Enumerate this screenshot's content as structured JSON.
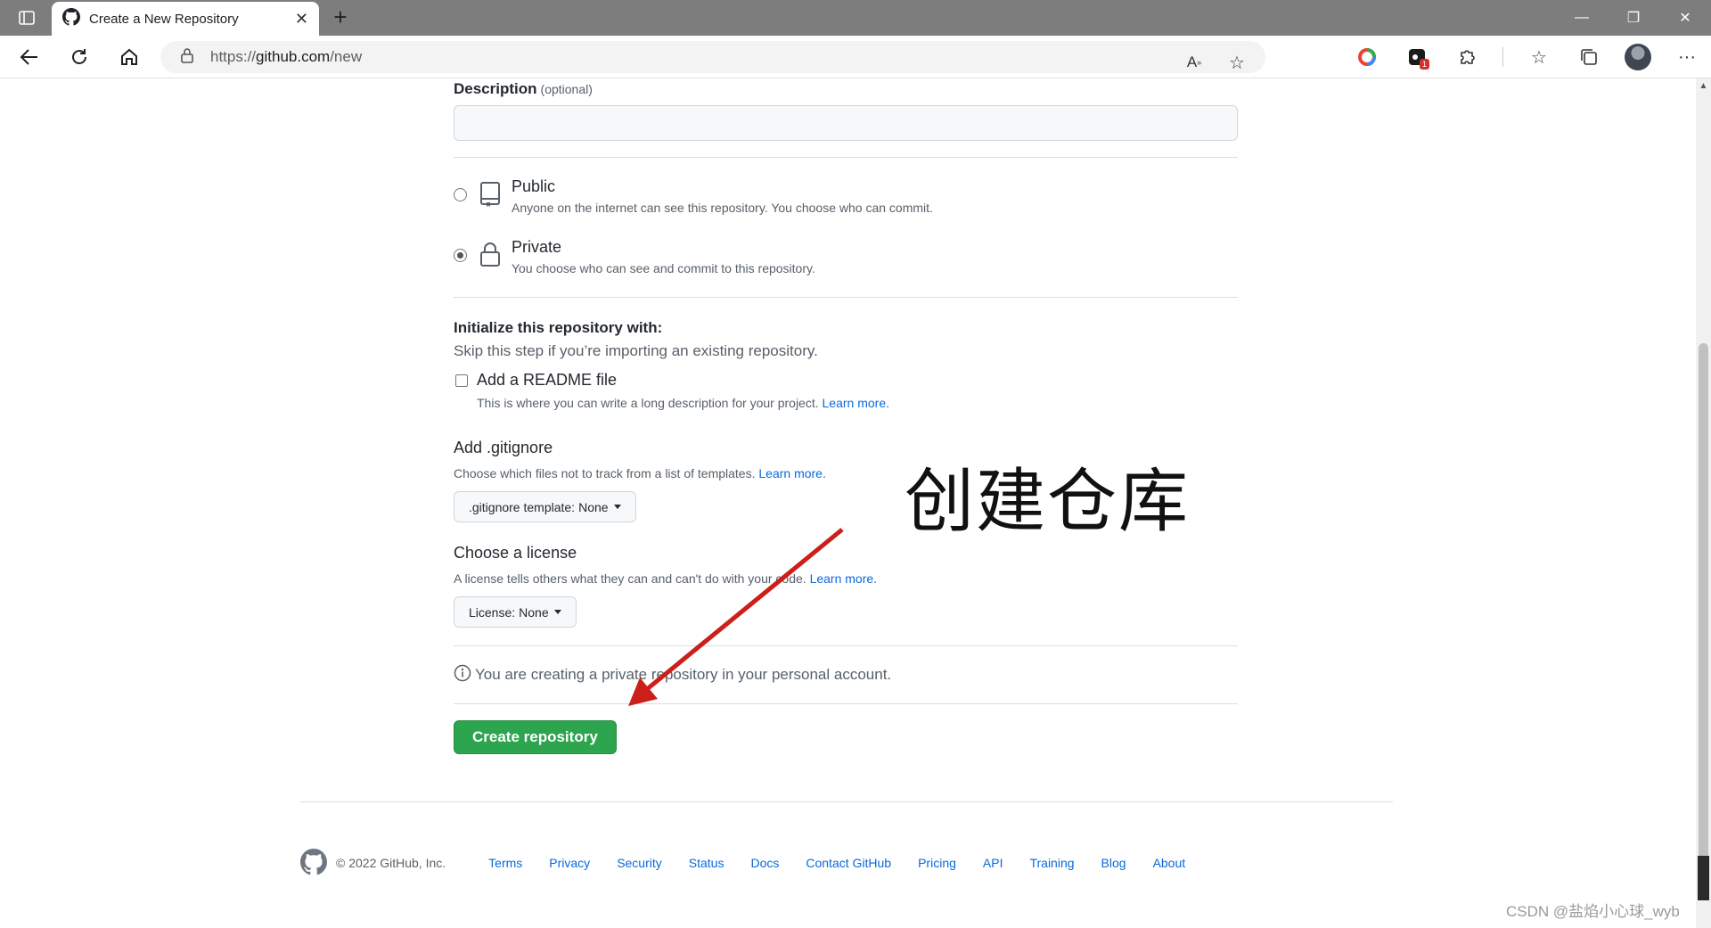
{
  "browser": {
    "tab_title": "Create a New Repository",
    "url_prefix": "https://",
    "url_host": "github.com",
    "url_path": "/new",
    "extension_badge": "1"
  },
  "form": {
    "description_label": "Description",
    "description_optional": "(optional)",
    "visibility": [
      {
        "title": "Public",
        "desc": "Anyone on the internet can see this repository. You choose who can commit.",
        "checked": false
      },
      {
        "title": "Private",
        "desc": "You choose who can see and commit to this repository.",
        "checked": true
      }
    ],
    "init_title": "Initialize this repository with:",
    "init_sub": "Skip this step if you’re importing an existing repository.",
    "readme_title": "Add a README file",
    "readme_desc": "This is where you can write a long description for your project.",
    "learn_more": "Learn more.",
    "gitignore_title": "Add .gitignore",
    "gitignore_desc": "Choose which files not to track from a list of templates.",
    "gitignore_btn_prefix": ".gitignore template:",
    "gitignore_btn_value": "None",
    "license_title": "Choose a license",
    "license_desc": "A license tells others what they can and can't do with your code.",
    "license_btn_prefix": "License:",
    "license_btn_value": "None",
    "info_text": "You are creating a private repository in your personal account.",
    "create_button": "Create repository"
  },
  "footer": {
    "copyright": "© 2022 GitHub, Inc.",
    "links": [
      "Terms",
      "Privacy",
      "Security",
      "Status",
      "Docs",
      "Contact GitHub",
      "Pricing",
      "API",
      "Training",
      "Blog",
      "About"
    ]
  },
  "annotation": {
    "text": "创建仓库",
    "arrow_color": "#cc1f1a"
  },
  "watermark": "CSDN @盐焰小心球_wyb",
  "colors": {
    "accent": "#2da44e",
    "link": "#0969da"
  }
}
